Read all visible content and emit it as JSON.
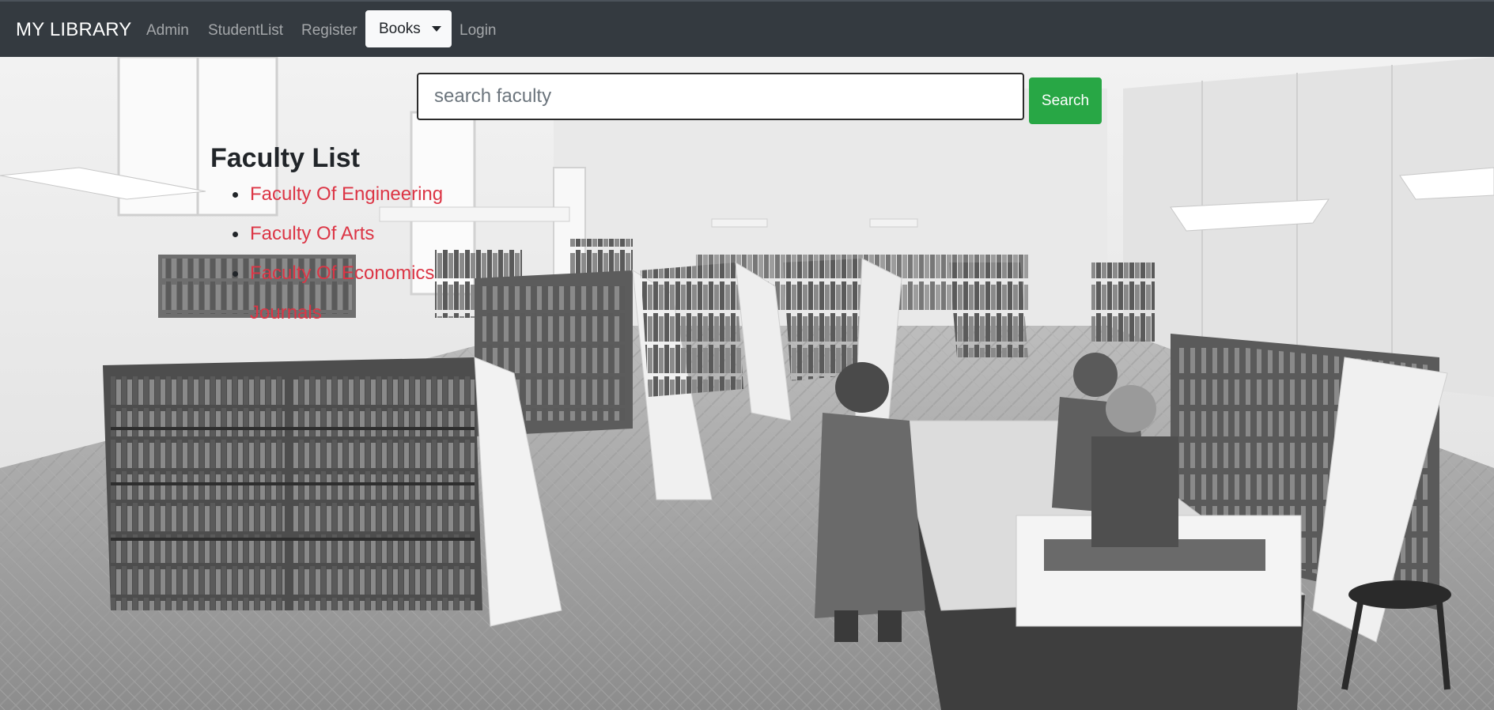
{
  "navbar": {
    "brand": "MY LIBRARY",
    "links": [
      "Admin",
      "StudentList",
      "Register",
      "Login"
    ],
    "books_dropdown": "Books"
  },
  "search": {
    "placeholder": "search faculty",
    "value": "",
    "button_label": "Search"
  },
  "faculty": {
    "title": "Faculty List",
    "items": [
      "Faculty Of Engineering",
      "Faculty Of Arts",
      "Faculty Of Economics",
      "Journals"
    ]
  },
  "colors": {
    "navbar_bg": "#343a40",
    "search_button": "#28a745",
    "link": "#dc3545"
  },
  "icons": [
    "caret-down-icon",
    "bullet-icon"
  ]
}
